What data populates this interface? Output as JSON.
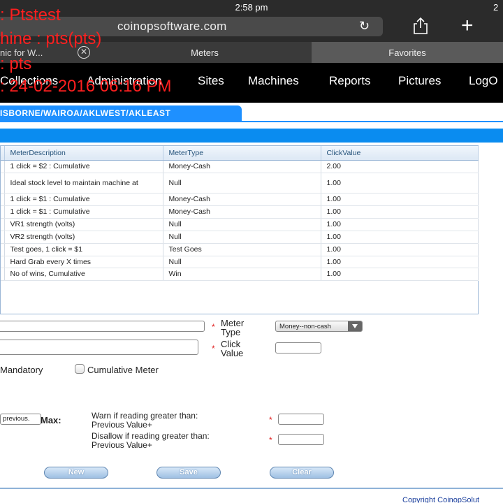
{
  "status": {
    "time": "2:58 pm",
    "time_right": "2"
  },
  "browser": {
    "url": "coinopsoftware.com",
    "tabs": [
      {
        "label": "nic for W..."
      },
      {
        "label": "Meters"
      },
      {
        "label": "Favorites"
      }
    ]
  },
  "nav": {
    "items": [
      "Collections",
      "Administration",
      "Sites",
      "Machines",
      "Reports",
      "Pictures",
      "LogO"
    ]
  },
  "overlay": {
    "line1": ": Ptstest",
    "line2": "hine : pts(pts)",
    "line3": ": pts",
    "line4": ": 24-02-2016 06:16 PM"
  },
  "location": "ISBORNE/WAIROA/AKLWEST/AKLEAST",
  "table": {
    "headers": [
      "MeterDescription",
      "MeterType",
      "ClickValue"
    ],
    "rows": [
      [
        "1 click = $2 : Cumulative",
        "Money-Cash",
        "2.00"
      ],
      [
        "Ideal stock level to maintain machine at",
        "Null",
        "1.00"
      ],
      [
        "1 click = $1 : Cumulative",
        "Money-Cash",
        "1.00"
      ],
      [
        "1 click = $1 : Cumulative",
        "Money-Cash",
        "1.00"
      ],
      [
        "VR1 strength (volts)",
        "Null",
        "1.00"
      ],
      [
        "VR2 strength (volts)",
        "Null",
        "1.00"
      ],
      [
        "Test goes, 1 click = $1",
        "Test Goes",
        "1.00"
      ],
      [
        "Hard Grab every X times",
        "Null",
        "1.00"
      ],
      [
        "No of wins, Cumulative",
        "Win",
        "1.00"
      ]
    ]
  },
  "form": {
    "meter_type_label1": "Meter",
    "meter_type_label2": "Type",
    "meter_type_value": "Money--non-cash",
    "click_value_label1": "Click",
    "click_value_label2": "Value",
    "mandatory_label": "Mandatory",
    "cumulative_label": "Cumulative Meter",
    "prev_button": "previous.",
    "max_label": "Max:",
    "warn_label1": "Warn if reading greater than:",
    "warn_label2": "Previous Value+",
    "disallow_label1": "Disallow if reading greater than:",
    "disallow_label2": "Previous Value+",
    "required_mark": "*"
  },
  "buttons": {
    "new": "New",
    "save": "Save",
    "clear": "Clear"
  },
  "footer": "Copyright  CoinopSolut"
}
